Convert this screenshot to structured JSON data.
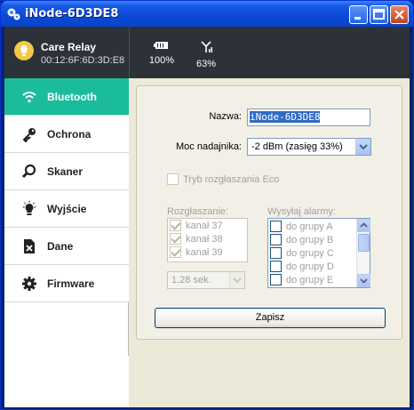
{
  "window": {
    "title": "iNode-6D3DE8"
  },
  "device": {
    "name": "Care Relay",
    "mac": "00:12:6F:6D:3D:E8"
  },
  "stats": {
    "battery": "100%",
    "signal": "63%"
  },
  "sidebar": {
    "items": [
      {
        "label": "Bluetooth",
        "icon": "wifi-icon",
        "active": true
      },
      {
        "label": "Ochrona",
        "icon": "key-icon"
      },
      {
        "label": "Skaner",
        "icon": "magnifier-icon"
      },
      {
        "label": "Wyjście",
        "icon": "bulb-icon"
      },
      {
        "label": "Dane",
        "icon": "file-delete-icon"
      },
      {
        "label": "Firmware",
        "icon": "gear-icon"
      }
    ]
  },
  "form": {
    "name_label": "Nazwa:",
    "name_value": "iNode-6D3DE8",
    "power_label": "Moc nadajnika:",
    "power_value": "-2 dBm  (zasięg 33%)",
    "eco_label": "Tryb rozgłaszania Eco",
    "broadcast_title": "Rozgłaszanie:",
    "channels": [
      "kanał 37",
      "kanał 38",
      "kanał 39"
    ],
    "interval_value": "1.28 sek.",
    "alarms_title": "Wysyłaj alarmy:",
    "groups": [
      "do grupy A",
      "do grupy B",
      "do grupy C",
      "do grupy D",
      "do grupy E"
    ],
    "save_label": "Zapisz"
  },
  "colors": {
    "accent": "#1abc9c",
    "header": "#2d3138",
    "titlebar": "#0a4ad6"
  }
}
